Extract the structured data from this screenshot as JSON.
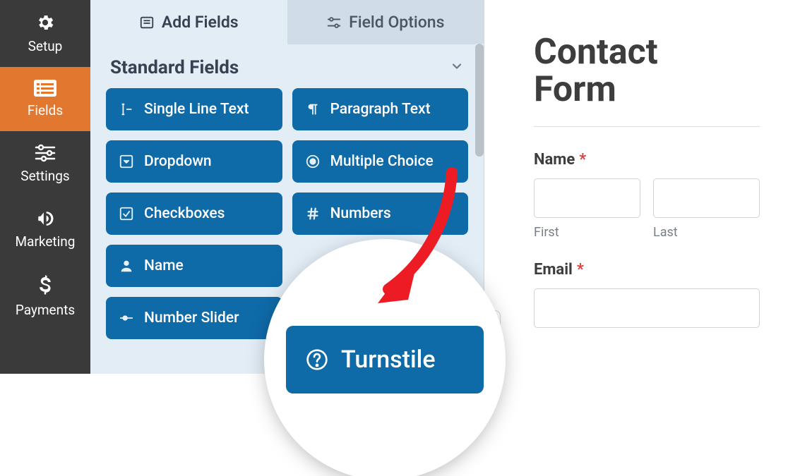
{
  "nav": {
    "items": [
      {
        "key": "setup",
        "label": "Setup"
      },
      {
        "key": "fields",
        "label": "Fields"
      },
      {
        "key": "settings",
        "label": "Settings"
      },
      {
        "key": "marketing",
        "label": "Marketing"
      },
      {
        "key": "payments",
        "label": "Payments"
      }
    ],
    "active": "fields"
  },
  "tabs": {
    "add_fields": "Add Fields",
    "field_options": "Field Options",
    "active": "add_fields"
  },
  "section": {
    "standard_title": "Standard Fields"
  },
  "fields": {
    "single_line_text": "Single Line Text",
    "paragraph_text": "Paragraph Text",
    "dropdown": "Dropdown",
    "multiple_choice": "Multiple Choice",
    "checkboxes": "Checkboxes",
    "numbers": "Numbers",
    "name": "Name",
    "number_slider": "Number Slider",
    "turnstile": "Turnstile"
  },
  "preview": {
    "title_line1": "Contact",
    "title_line2": "Form",
    "name_label": "Name",
    "first_sub": "First",
    "last_sub": "Last",
    "email_label": "Email",
    "required": "*"
  },
  "colors": {
    "accent": "#e27730",
    "field_btn": "#0f6aa8",
    "panel": "#e3edf6"
  }
}
